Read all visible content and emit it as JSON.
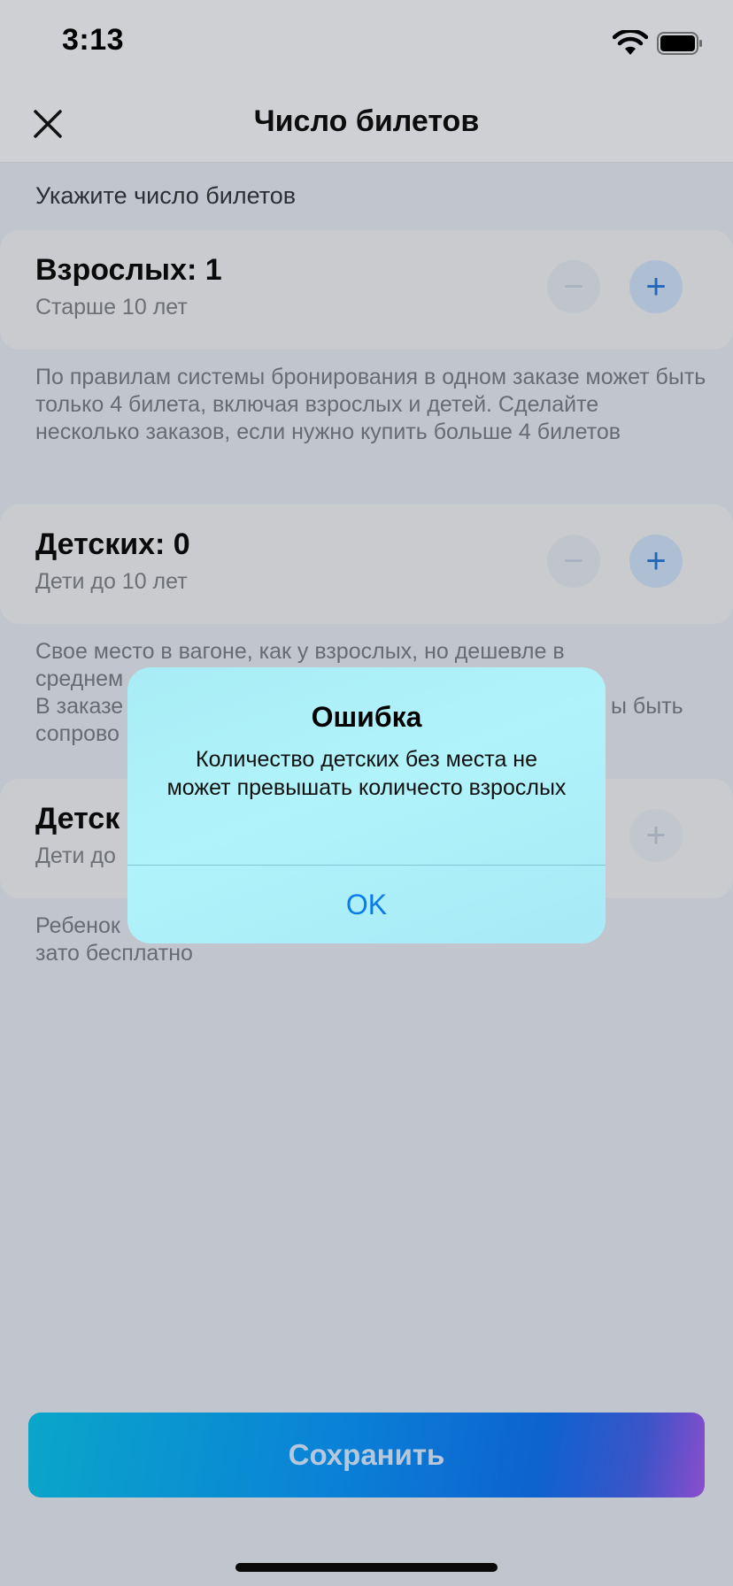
{
  "status_bar": {
    "time": "3:13"
  },
  "header": {
    "title": "Число билетов"
  },
  "section_hint": "Укажите число билетов",
  "adults": {
    "title": "Взрослых: 1",
    "subtitle": "Старше 10 лет",
    "note": "По правилам системы бронирования в одном заказе может быть только 4 билета, включая взрослых и детей. Сделайте несколько заказов, если нужно купить больше 4 билетов"
  },
  "children": {
    "title": "Детских: 0",
    "subtitle": "Дети до 10 лет",
    "note_line1": "Свое место в вагоне, как у взрослых, но дешевле в",
    "note_line2": "среднем",
    "note_line3_left": "В заказе",
    "note_line3_right": "ы быть",
    "note_line4": "сопрово"
  },
  "infants": {
    "title_partial": "Детск",
    "subtitle_partial": "Дети до",
    "note_line1": "Ребенок",
    "note_line2": "зато бесплатно"
  },
  "stepper": {
    "minus": "−",
    "plus": "+"
  },
  "alert": {
    "title": "Ошибка",
    "message": "Количество детских без места не может превышать количесто взрослых",
    "ok_label": "OK"
  },
  "save_label": "Сохранить"
}
